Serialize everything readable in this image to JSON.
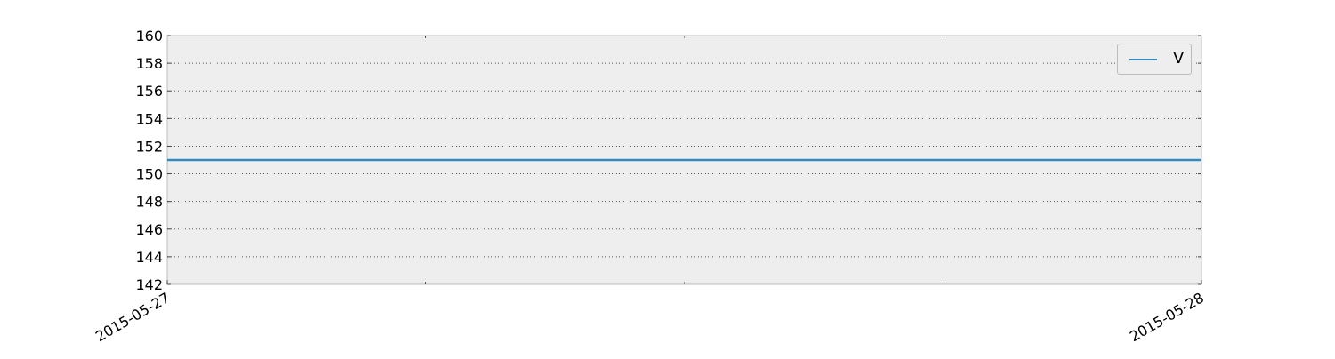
{
  "chart_data": {
    "type": "line",
    "title": "",
    "xlabel": "",
    "ylabel": "",
    "x": [
      "2015-05-27",
      "2015-05-28"
    ],
    "x_tick_labels": [
      "2015-05-27",
      "2015-05-28"
    ],
    "ylim": [
      142,
      160
    ],
    "y_ticks": [
      142,
      144,
      146,
      148,
      150,
      152,
      154,
      156,
      158,
      160
    ],
    "grid": true,
    "legend_position": "upper right",
    "series": [
      {
        "name": "V",
        "values": [
          151,
          151
        ],
        "color": "#348abd"
      }
    ],
    "colors": {
      "plot_background": "#eeeeee",
      "axes_edge": "#bcbcbc",
      "grid": "#555555"
    }
  }
}
